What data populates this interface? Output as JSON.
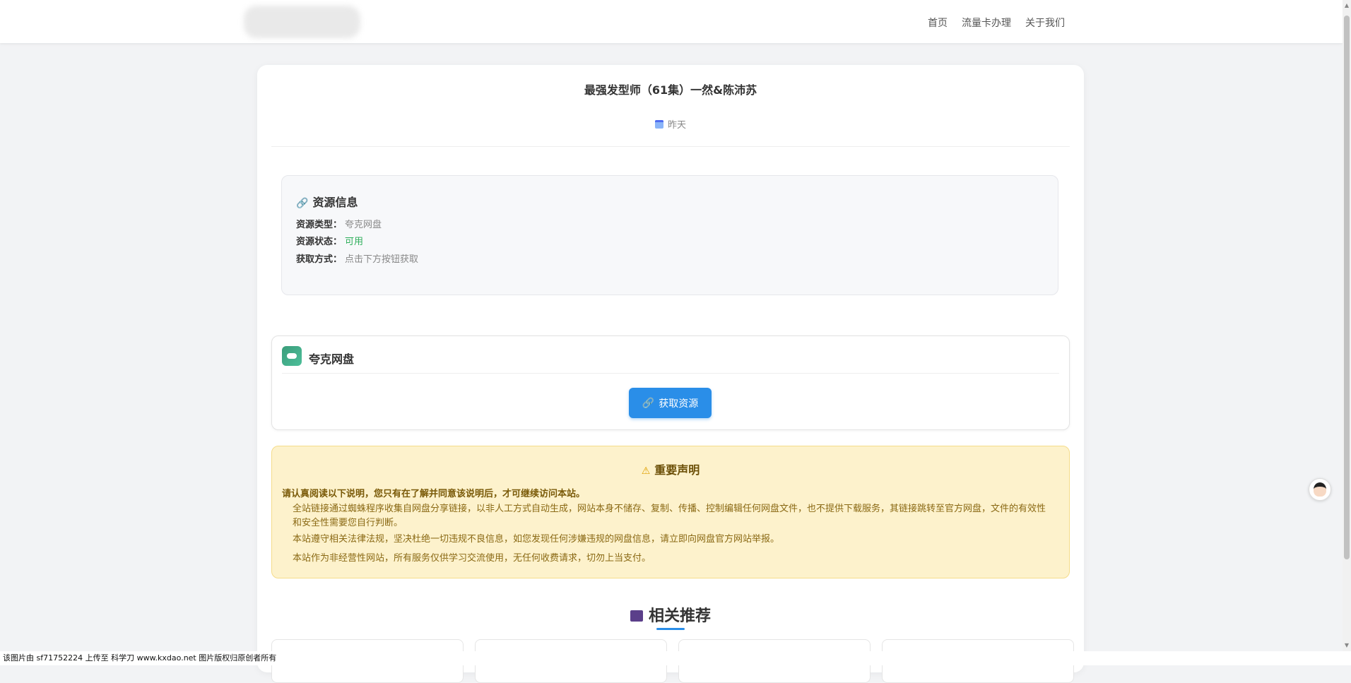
{
  "nav": {
    "links": [
      "首页",
      "流量卡办理",
      "关于我们"
    ]
  },
  "article": {
    "title": "最强发型师（61集）一然&陈沛苏",
    "date": "昨天"
  },
  "resource_info": {
    "heading": "资源信息",
    "rows": [
      {
        "key": "资源类型：",
        "value": "夸克网盘"
      },
      {
        "key": "资源状态：",
        "value": "可用"
      },
      {
        "key": "获取方式：",
        "value": "点击下方按钮获取"
      }
    ]
  },
  "pan": {
    "name": "夸克网盘",
    "button_label": "获取资源"
  },
  "notice": {
    "heading": "重要声明",
    "lead": "请认真阅读以下说明，您只有在了解并同意该说明后，才可继续访问本站。",
    "items": [
      "全站链接通过蜘蛛程序收集自网盘分享链接，以非人工方式自动生成，网站本身不储存、复制、传播、控制编辑任何网盘文件，也不提供下载服务，其链接跳转至官方网盘，文件的有效性和安全性需要您自行判断。",
      "本站遵守相关法律法规，坚决杜绝一切违规不良信息，如您发现任何涉嫌违规的网盘信息，请立即向网盘官方网站举报。",
      "本站作为非经营性网站，所有服务仅供学习交流使用，无任何收费请求，切勿上当支付。"
    ]
  },
  "related": {
    "heading": "相关推荐"
  },
  "footer": {
    "text": "该图片由 sf71752224 上传至 科学刀 www.kxdao.net 图片版权归原创者所有"
  },
  "icons": {
    "date": "calendar-icon",
    "resource": "link-icon",
    "pan": "quark-cloud-icon",
    "button": "link-icon",
    "notice": "warning-icon",
    "related": "clapperboard-icon"
  },
  "colors": {
    "accent": "#2a8ee8",
    "status_ok": "#2eae5a",
    "notice_bg": "#fdf2cc"
  }
}
